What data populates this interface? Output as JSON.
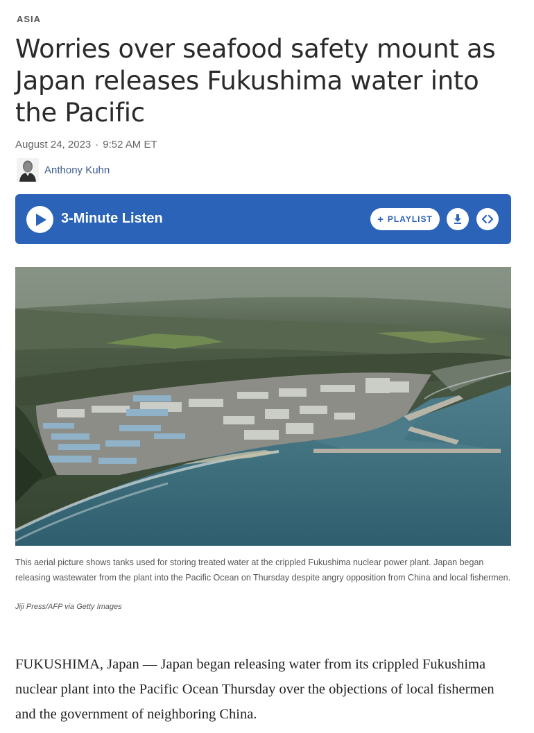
{
  "section": "ASIA",
  "headline": "Worries over seafood safety mount as Japan releases Fukushima water into the Pacific",
  "date": "August 24, 2023",
  "date_separator": "·",
  "time": "9:52 AM ET",
  "author": "Anthony Kuhn",
  "player": {
    "listen_label": "3-Minute Listen",
    "playlist_icon": "plus-icon",
    "playlist_label": "PLAYLIST",
    "download_icon": "download-icon",
    "embed_icon": "embed-icon",
    "play_icon": "play-icon",
    "background_color": "#2b63b8"
  },
  "image": {
    "caption": "This aerial picture shows tanks used for storing treated water at the crippled Fukushima nuclear power plant. Japan began releasing wastewater from the plant into the Pacific Ocean on Thursday despite angry opposition from China and local fishermen.",
    "credit": "Jiji Press/AFP via Getty Images"
  },
  "body": {
    "paragraph_1": "FUKUSHIMA, Japan — Japan began releasing water from its crippled Fukushima nuclear plant into the Pacific Ocean Thursday over the objections of local fishermen and the government of neighboring China."
  }
}
